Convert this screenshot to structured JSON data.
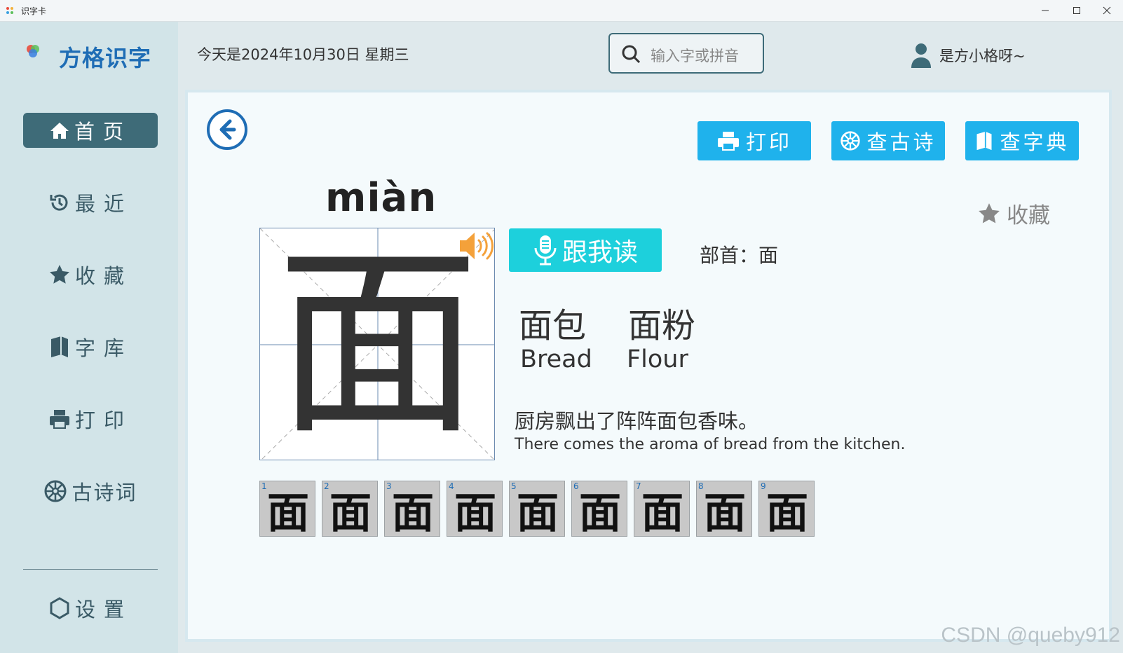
{
  "window": {
    "title": "识字卡"
  },
  "sidebar": {
    "brand": "方格识字",
    "items": [
      {
        "label": "首页",
        "icon": "home-icon",
        "active": true
      },
      {
        "label": "最近",
        "icon": "history-icon"
      },
      {
        "label": "收藏",
        "icon": "star-icon"
      },
      {
        "label": "字库",
        "icon": "book-icon"
      },
      {
        "label": "打印",
        "icon": "printer-icon"
      },
      {
        "label": "古诗词",
        "icon": "poem-icon"
      }
    ],
    "settings": {
      "label": "设置",
      "icon": "hexagon-icon"
    }
  },
  "header": {
    "date": "今天是2024年10月30日 星期三",
    "search_placeholder": "输入字或拼音",
    "user_name": "是方小格呀~"
  },
  "card": {
    "pinyin": "miàn",
    "character": "面",
    "favorite_label": "收藏",
    "actions": {
      "print": "打印",
      "poem": "查古诗",
      "dictionary": "查字典"
    },
    "read_label": "跟我读",
    "radical": "部首：面",
    "words": [
      {
        "zh": "面包",
        "en": "Bread"
      },
      {
        "zh": "面粉",
        "en": "Flour"
      }
    ],
    "sentence_zh": "厨房飘出了阵阵面包香味。",
    "sentence_en": "There comes the aroma of bread from the kitchen.",
    "strokes": [
      {
        "n": "1",
        "ch": "面"
      },
      {
        "n": "2",
        "ch": "面"
      },
      {
        "n": "3",
        "ch": "面"
      },
      {
        "n": "4",
        "ch": "面"
      },
      {
        "n": "5",
        "ch": "面"
      },
      {
        "n": "6",
        "ch": "面"
      },
      {
        "n": "7",
        "ch": "面"
      },
      {
        "n": "8",
        "ch": "面"
      },
      {
        "n": "9",
        "ch": "面"
      }
    ]
  },
  "watermark": "CSDN @queby912",
  "colors": {
    "accent": "#1fb2ec",
    "active_nav": "#3e6b78",
    "read_button": "#1dd0dc",
    "brand": "#1f6db5"
  }
}
